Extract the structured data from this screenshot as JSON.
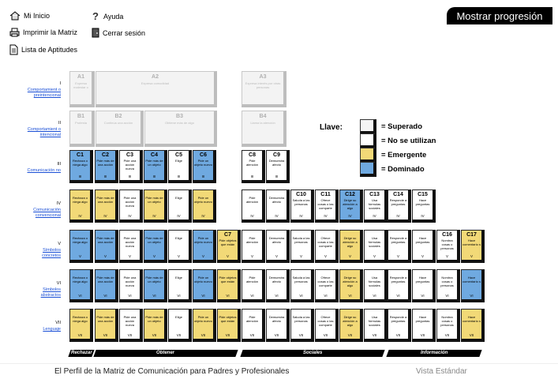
{
  "nav": {
    "home": "Mi Inicio",
    "print": "Imprimir la Matriz",
    "skills": "Lista de Aptitudes",
    "help": "Ayuda",
    "logout": "Cerrar sesión",
    "progress": "Mostrar progresión"
  },
  "levels": [
    {
      "roman": "I",
      "label": "Comportamient o preintencional"
    },
    {
      "roman": "II",
      "label": "Comportamient o intencional"
    },
    {
      "roman": "III",
      "label": "Comunicación no"
    },
    {
      "roman": "IV",
      "label": "Comunicación convencional"
    },
    {
      "roman": "V",
      "label": "Símbolos concretos"
    },
    {
      "roman": "VI",
      "label": "Símbolos abstractos"
    },
    {
      "roman": "VII",
      "label": "Lenguaje"
    }
  ],
  "ghosts": {
    "A1": {
      "code": "A1",
      "text": "Expresa malestar o"
    },
    "A2": {
      "code": "A2",
      "text": "Expresa comodidad"
    },
    "A3": {
      "code": "A3",
      "text": "Expresa interés por otras personas"
    },
    "B1": {
      "code": "B1",
      "text": "Protesta"
    },
    "B2": {
      "code": "B2",
      "text": "Continúa una acción"
    },
    "B3": {
      "code": "B3",
      "text": "Obtiene más de algo"
    },
    "B4": {
      "code": "B4",
      "text": "Llama la atención"
    }
  },
  "legend": {
    "title": "Llave:",
    "items": [
      {
        "label": "= Superado",
        "color": "#f5f5f5"
      },
      {
        "label": "= No se utilizan",
        "color": "#ffffff"
      },
      {
        "label": "= Emergente",
        "color": "#f2d977"
      },
      {
        "label": "= Dominado",
        "color": "#6fa9e0"
      }
    ]
  },
  "matrix": {
    "C1": {
      "code": "C1",
      "text": "Rechaza o niega algo"
    },
    "C2": {
      "code": "C2",
      "text": "Pide más de una acción"
    },
    "C3": {
      "code": "C3",
      "text": "Pide una acción nueva"
    },
    "C4": {
      "code": "C4",
      "text": "Pide más de un objeto"
    },
    "C5": {
      "code": "C5",
      "text": "Elige"
    },
    "C6": {
      "code": "C6",
      "text": "Pide un objeto nuevo"
    },
    "C7": {
      "code": "C7",
      "text": "Pide objetos que están"
    },
    "C8": {
      "code": "C8",
      "text": "Pide atención"
    },
    "C9": {
      "code": "C9",
      "text": "Demuestra afecto"
    },
    "C10": {
      "code": "C10",
      "text": "Saluda a las personas"
    },
    "C11": {
      "code": "C11",
      "text": "Ofrece cosas o las comparte"
    },
    "C12": {
      "code": "C12",
      "text": "Dirige su atención a algo"
    },
    "C13": {
      "code": "C13",
      "text": "Usa fórmulas sociales"
    },
    "C14": {
      "code": "C14",
      "text": "Responde a preguntas"
    },
    "C15": {
      "code": "C15",
      "text": "Hace preguntas"
    },
    "C16": {
      "code": "C16",
      "text": "Nombra cosas o personas"
    },
    "C17": {
      "code": "C17",
      "text": "Hace comentario s"
    }
  },
  "row_states": {
    "III": [
      "D",
      "D",
      "S",
      "D",
      "S",
      "D",
      null,
      "S",
      "S",
      null,
      null,
      null,
      null,
      null,
      null,
      null,
      null
    ],
    "IV": [
      "E",
      "E",
      "S",
      "E",
      "S",
      "E",
      null,
      "S",
      "S",
      "S",
      "S",
      "D",
      "S",
      "S",
      "S",
      null,
      null
    ],
    "V": [
      "D",
      "D",
      "S",
      "D",
      "S",
      "D",
      "E",
      "S",
      "S",
      "S",
      "S",
      "E",
      "S",
      "S",
      "S",
      "S",
      "E"
    ],
    "VI": [
      "D",
      "D",
      "S",
      "D",
      "S",
      "D",
      "E",
      "S",
      "S",
      "S",
      "S",
      "E",
      "S",
      "S",
      "S",
      "S",
      "D"
    ],
    "VII": [
      "E",
      "E",
      "S",
      "E",
      "S",
      "E",
      "E",
      "S",
      "S",
      "S",
      "S",
      "E",
      "S",
      "S",
      "S",
      "S",
      "E"
    ]
  },
  "row_lower": {
    "III": [
      "Rechaza o niega algo",
      "Pide más de una acción",
      "Pide una acción nueva",
      "Pide más de un objeto",
      "Elige",
      "Pide un objeto nuevo",
      "",
      "Pide atención",
      "Demuestra afecto",
      "",
      "",
      "",
      "",
      "",
      "",
      "",
      ""
    ]
  },
  "bands": [
    "Rechazar",
    "Obtener",
    "Sociales",
    "Información"
  ],
  "footer": {
    "title": "El Perfil de la Matriz de Comunicación para Padres y Profesionales",
    "view": "Vista Estándar"
  }
}
